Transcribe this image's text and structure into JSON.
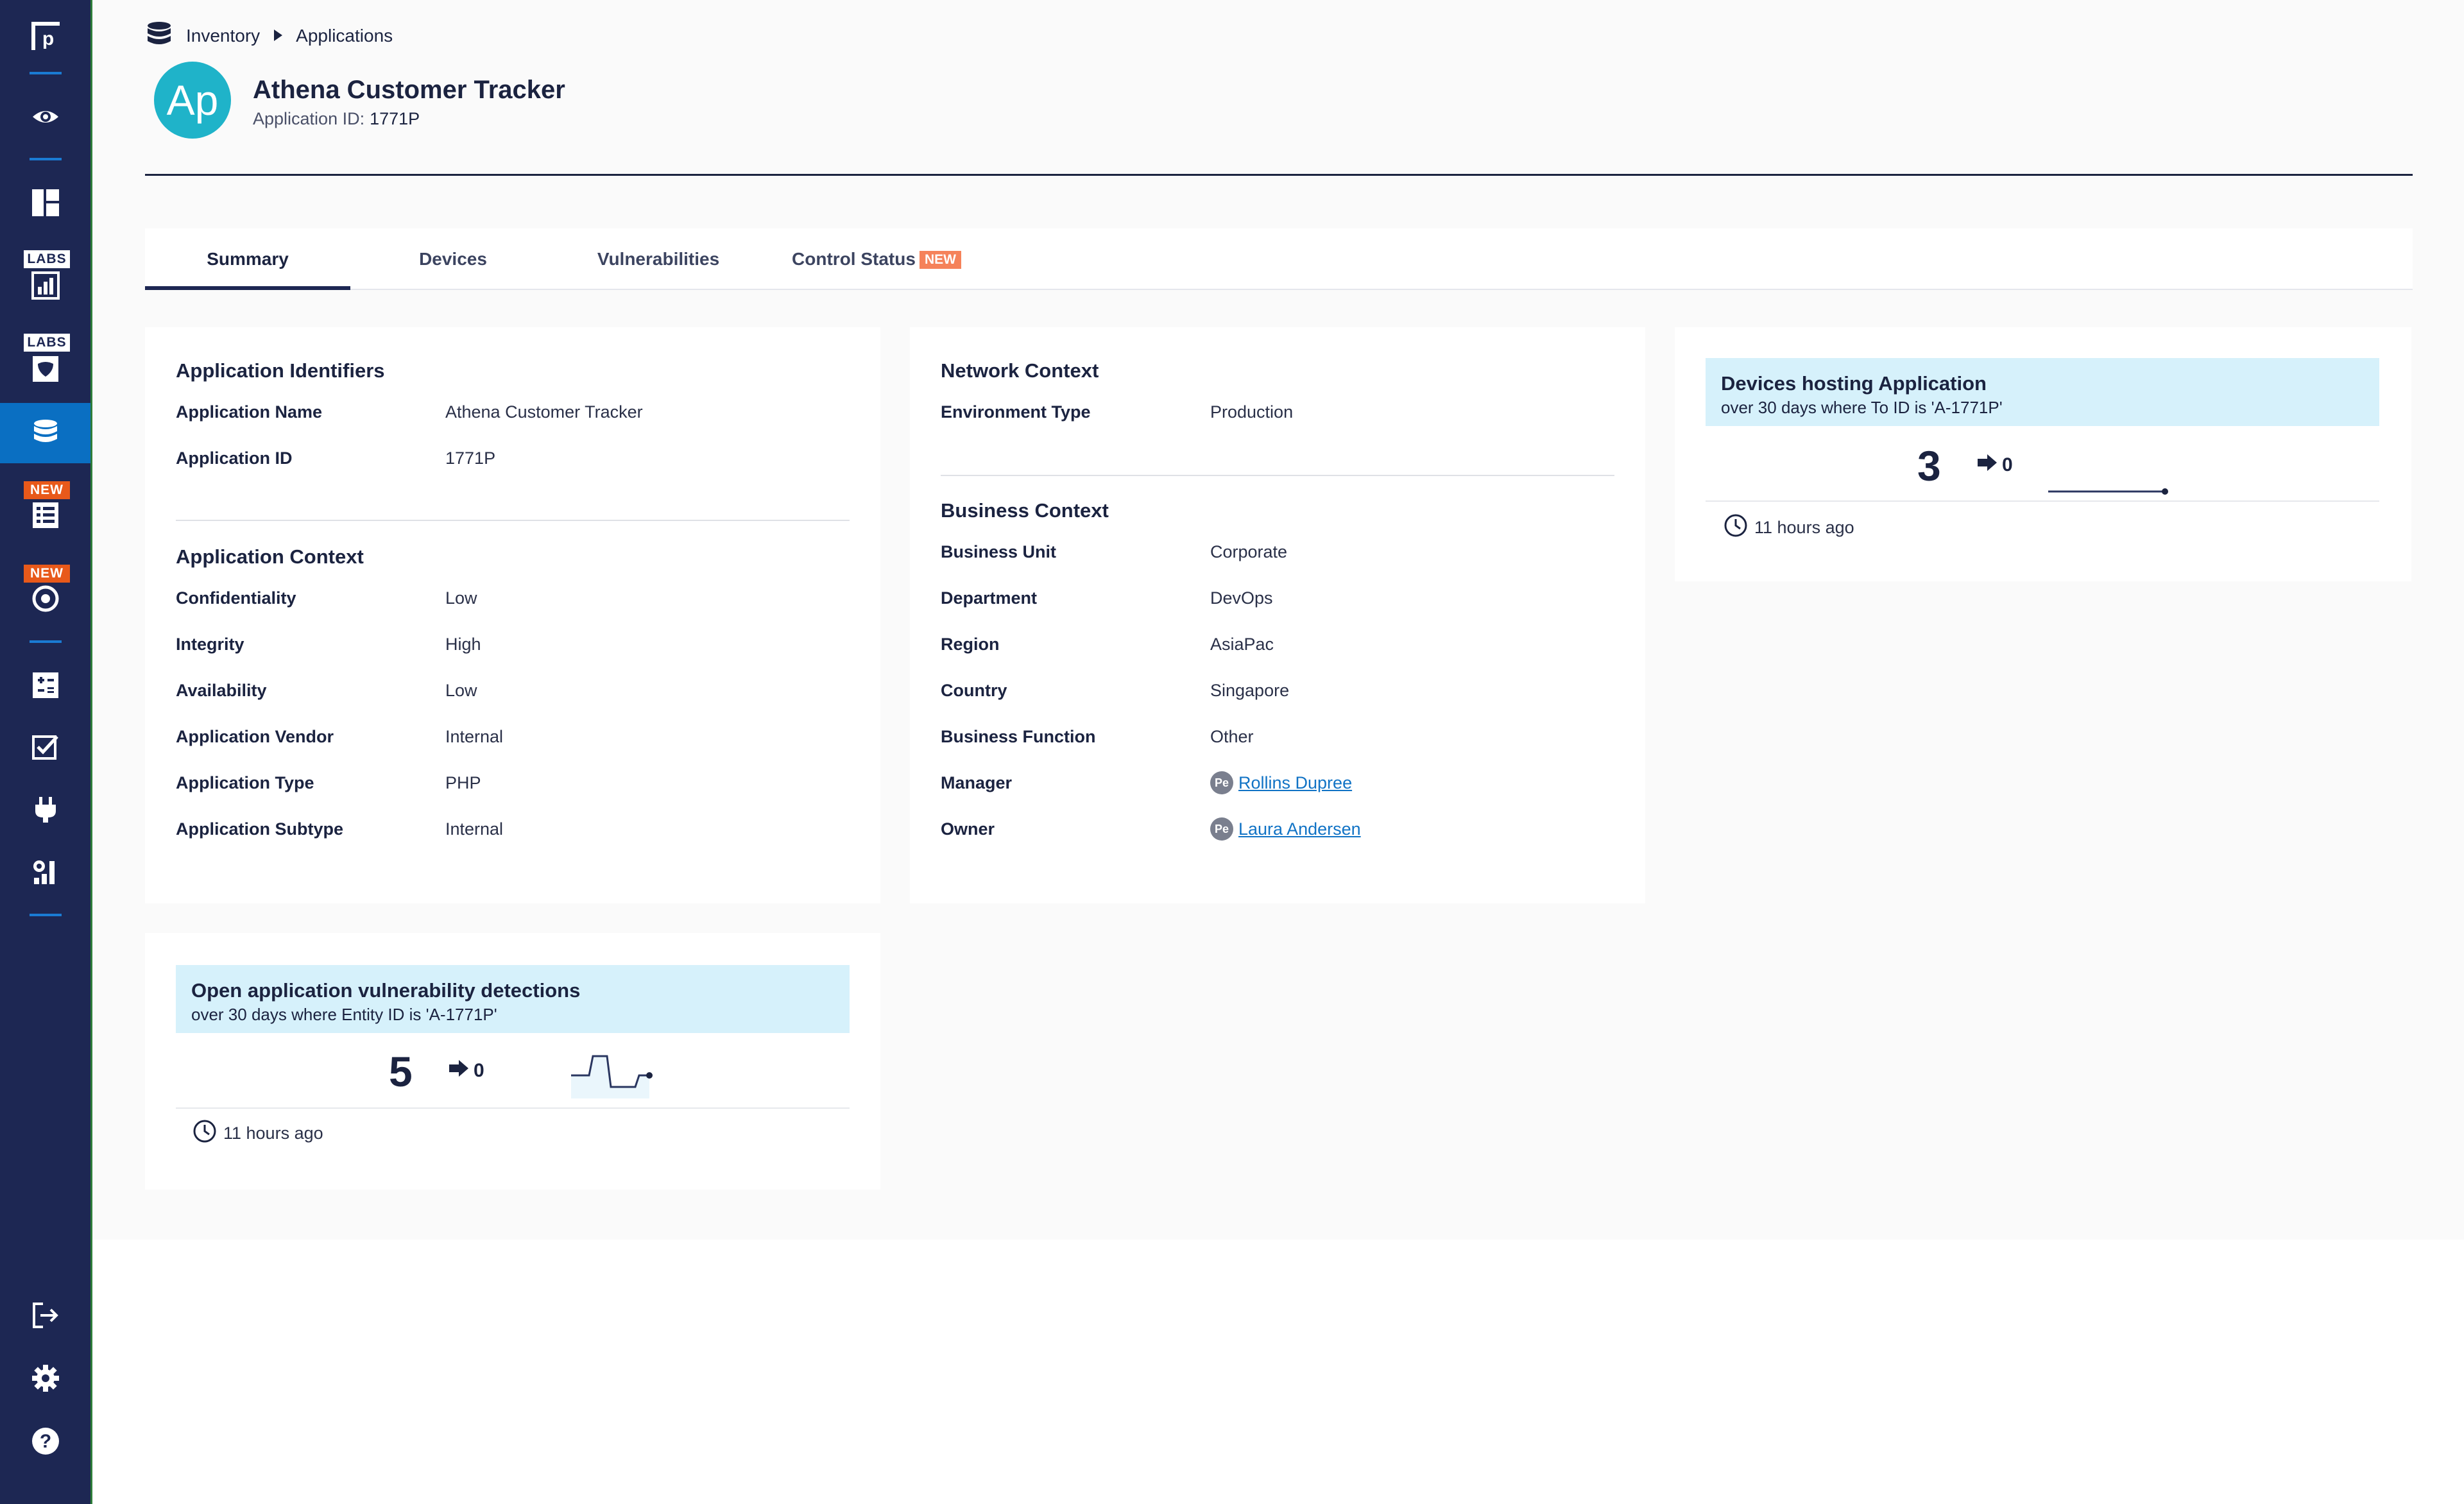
{
  "breadcrumb": {
    "parent": "Inventory",
    "current": "Applications"
  },
  "app": {
    "initials": "Ap",
    "name": "Athena Customer Tracker",
    "id_label": "Application ID:",
    "id_value": "1771P"
  },
  "tabs": [
    {
      "label": "Summary",
      "active": true
    },
    {
      "label": "Devices"
    },
    {
      "label": "Vulnerabilities"
    },
    {
      "label": "Control Status",
      "tag": "NEW"
    }
  ],
  "identifiers": {
    "title": "Application Identifiers",
    "rows": [
      {
        "k": "Application Name",
        "v": "Athena Customer Tracker"
      },
      {
        "k": "Application ID",
        "v": "1771P"
      }
    ]
  },
  "app_context": {
    "title": "Application Context",
    "rows": [
      {
        "k": "Confidentiality",
        "v": "Low"
      },
      {
        "k": "Integrity",
        "v": "High"
      },
      {
        "k": "Availability",
        "v": "Low"
      },
      {
        "k": "Application Vendor",
        "v": "Internal"
      },
      {
        "k": "Application Type",
        "v": "PHP"
      },
      {
        "k": "Application Subtype",
        "v": "Internal"
      }
    ]
  },
  "network_context": {
    "title": "Network Context",
    "rows": [
      {
        "k": "Environment Type",
        "v": "Production"
      }
    ]
  },
  "business_context": {
    "title": "Business Context",
    "rows": [
      {
        "k": "Business Unit",
        "v": "Corporate"
      },
      {
        "k": "Department",
        "v": "DevOps"
      },
      {
        "k": "Region",
        "v": "AsiaPac"
      },
      {
        "k": "Country",
        "v": "Singapore"
      },
      {
        "k": "Business Function",
        "v": "Other"
      }
    ],
    "manager": {
      "label": "Manager",
      "initials": "Pe",
      "name": "Rollins Dupree"
    },
    "owner": {
      "label": "Owner",
      "initials": "Pe",
      "name": "Laura Andersen"
    }
  },
  "devices_widget": {
    "title": "Devices hosting Application",
    "subtitle": "over 30 days where To ID is 'A-1771P'",
    "value": "3",
    "delta": "0",
    "updated": "11 hours ago"
  },
  "vuln_widget": {
    "title": "Open application vulnerability detections",
    "subtitle": "over 30 days where Entity ID is 'A-1771P'",
    "value": "5",
    "delta": "0",
    "updated": "11 hours ago"
  },
  "sidebar": {
    "badges": {
      "labs": "LABS",
      "new": "NEW"
    },
    "icons": [
      "logo-icon",
      "eye-icon",
      "dashboard-icon",
      "reports-icon",
      "shield-icon",
      "inventory-icon",
      "checklist-icon",
      "target-icon",
      "calculator-icon",
      "task-icon",
      "plug-icon",
      "settings-chart-icon",
      "logout-icon",
      "gear-icon",
      "help-icon"
    ]
  },
  "colors": {
    "sidebar": "#1d2753",
    "active": "#0a6fc2",
    "accent": "#1fb3c9",
    "widget_header": "#d6f1fb"
  }
}
